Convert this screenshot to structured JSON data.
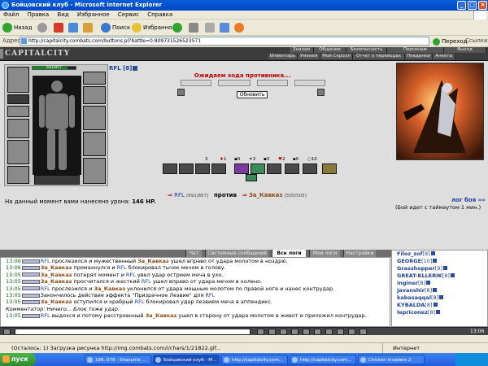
{
  "window": {
    "title": "Бойцовский клуб - Microsoft Internet Explorer"
  },
  "menu": [
    "Файл",
    "Правка",
    "Вид",
    "Избранное",
    "Сервис",
    "Справка"
  ],
  "toolbar": {
    "back": "Назад",
    "search": "Поиск",
    "favorites": "Избранное"
  },
  "address": {
    "label": "Адрес:",
    "url": "http://capitalcity.combats.com/buttons.pl?battle=0.809731526523571",
    "go": "Переход",
    "links": "Ссылки"
  },
  "game": {
    "logo": "CAPITALCITY",
    "nav_top": [
      "Знания",
      "Общение",
      "Безопасность",
      "Персонаж",
      "Выход"
    ],
    "nav_bottom": [
      "Инвентарь",
      "Умения",
      "Мой Скролл",
      "Отчет о переводах",
      "Поединки",
      "Анкета"
    ],
    "hp": "691/857",
    "char_name": "RFL [8]",
    "wait_text": "Ожидаем хода противника...",
    "refresh": "Обновить",
    "counts": [
      "3",
      "1",
      "0",
      "3",
      "0",
      "2",
      "0",
      "10"
    ],
    "damage_label": "На данный момент вами нанесено урона:",
    "damage_value": "146 HP.",
    "p1_name": "RFL",
    "p1_hp": "[691/857]",
    "vs": "против",
    "p2_name": "За_Кавказ",
    "p2_hp": "[505/505]",
    "battle_log": "лог боя »»",
    "timeout": "(Бой идет с таймаутом 1 мин.)"
  },
  "tabs": [
    "Чат",
    "Системные сообщения",
    "Все логи",
    "Мои логи",
    "Настройки"
  ],
  "chat": [
    {
      "time": "13:06",
      "a": "RFL",
      "t1": " прослезился и мужественный ",
      "b": "За_Кавказ",
      "t2": " ушел вправо от удара молотом в ноздрю."
    },
    {
      "time": "13:06",
      "a": "За_Кавказ",
      "t1": " промахнулся и ",
      "b": "RFL",
      "t2": " блокировал тычок мечом в голову."
    },
    {
      "time": "13:05",
      "a": "За_Кавказ",
      "t1": " потерял момент и ",
      "b": "RFL",
      "t2": " увел удар острием меча в ухо."
    },
    {
      "time": "13:05",
      "a": "За_Кавказ",
      "t1": " просчитался и жесткий ",
      "b": "RFL",
      "t2": " ушел вправо от удара мечом в колено."
    },
    {
      "time": "13:05",
      "a": "RFL",
      "t1": " прослезился и ",
      "b": "За_Кавказ",
      "t2": " уклонился от удара мощным молотом по правой ноге и нанес контрудар."
    },
    {
      "time": "13:05",
      "a": "",
      "t1": "Закончилось действие эффекта \"Призрачное Лезвие\" для ",
      "b": "RFL",
      "t2": ""
    },
    {
      "time": "13:05",
      "a": "За_Кавказ",
      "t1": " оступился и храбрый ",
      "b": "RFL",
      "t2": " блокировал удар лезвием меча в аппендикс."
    },
    {
      "time": "",
      "a": "",
      "t1": "Комментатор: Ничего... Блок тоже удар.",
      "b": "",
      "t2": ""
    },
    {
      "time": "13:05",
      "a": "RFL",
      "t1": " выдохся и потому расстроенный ",
      "b": "За_Кавказ",
      "t2": " ушел в сторону от удара молотом в живот и приложил контрудар."
    }
  ],
  "users": [
    {
      "name": "Filoz_zof",
      "lvl": "[8]"
    },
    {
      "name": "GEORGE",
      "lvl": "[10]"
    },
    {
      "name": "Grasshopper",
      "lvl": "[9]"
    },
    {
      "name": "GREAT-KLLERIK",
      "lvl": "[8]"
    },
    {
      "name": "inginer",
      "lvl": "[8]"
    },
    {
      "name": "Javanshir",
      "lvl": "[8]"
    },
    {
      "name": "kabasaqqal",
      "lvl": "[8]"
    },
    {
      "name": "KYBALDA",
      "lvl": "[8]"
    },
    {
      "name": "lepriconez",
      "lvl": "[8]"
    }
  ],
  "clock": "13:06",
  "status": {
    "text": "(Осталось: 1) Загрузка рисунка http://img.combats.com/i/chars/1/21822.gif...",
    "zone": "Интернет"
  },
  "taskbar": {
    "start": "пуск",
    "tasks": [
      "199. 079 - Shaxunts ...",
      "Бойцовский клуб - M...",
      "http://capitalcity.com...",
      "http://capitalcity.com...",
      "Chicken Invaders 2"
    ]
  },
  "colors": {
    "accent_blue": "#1e3f9a",
    "opponent_brown": "#8a4a12",
    "wait_red": "#c20000",
    "hp_green": "#0b8f1b"
  }
}
